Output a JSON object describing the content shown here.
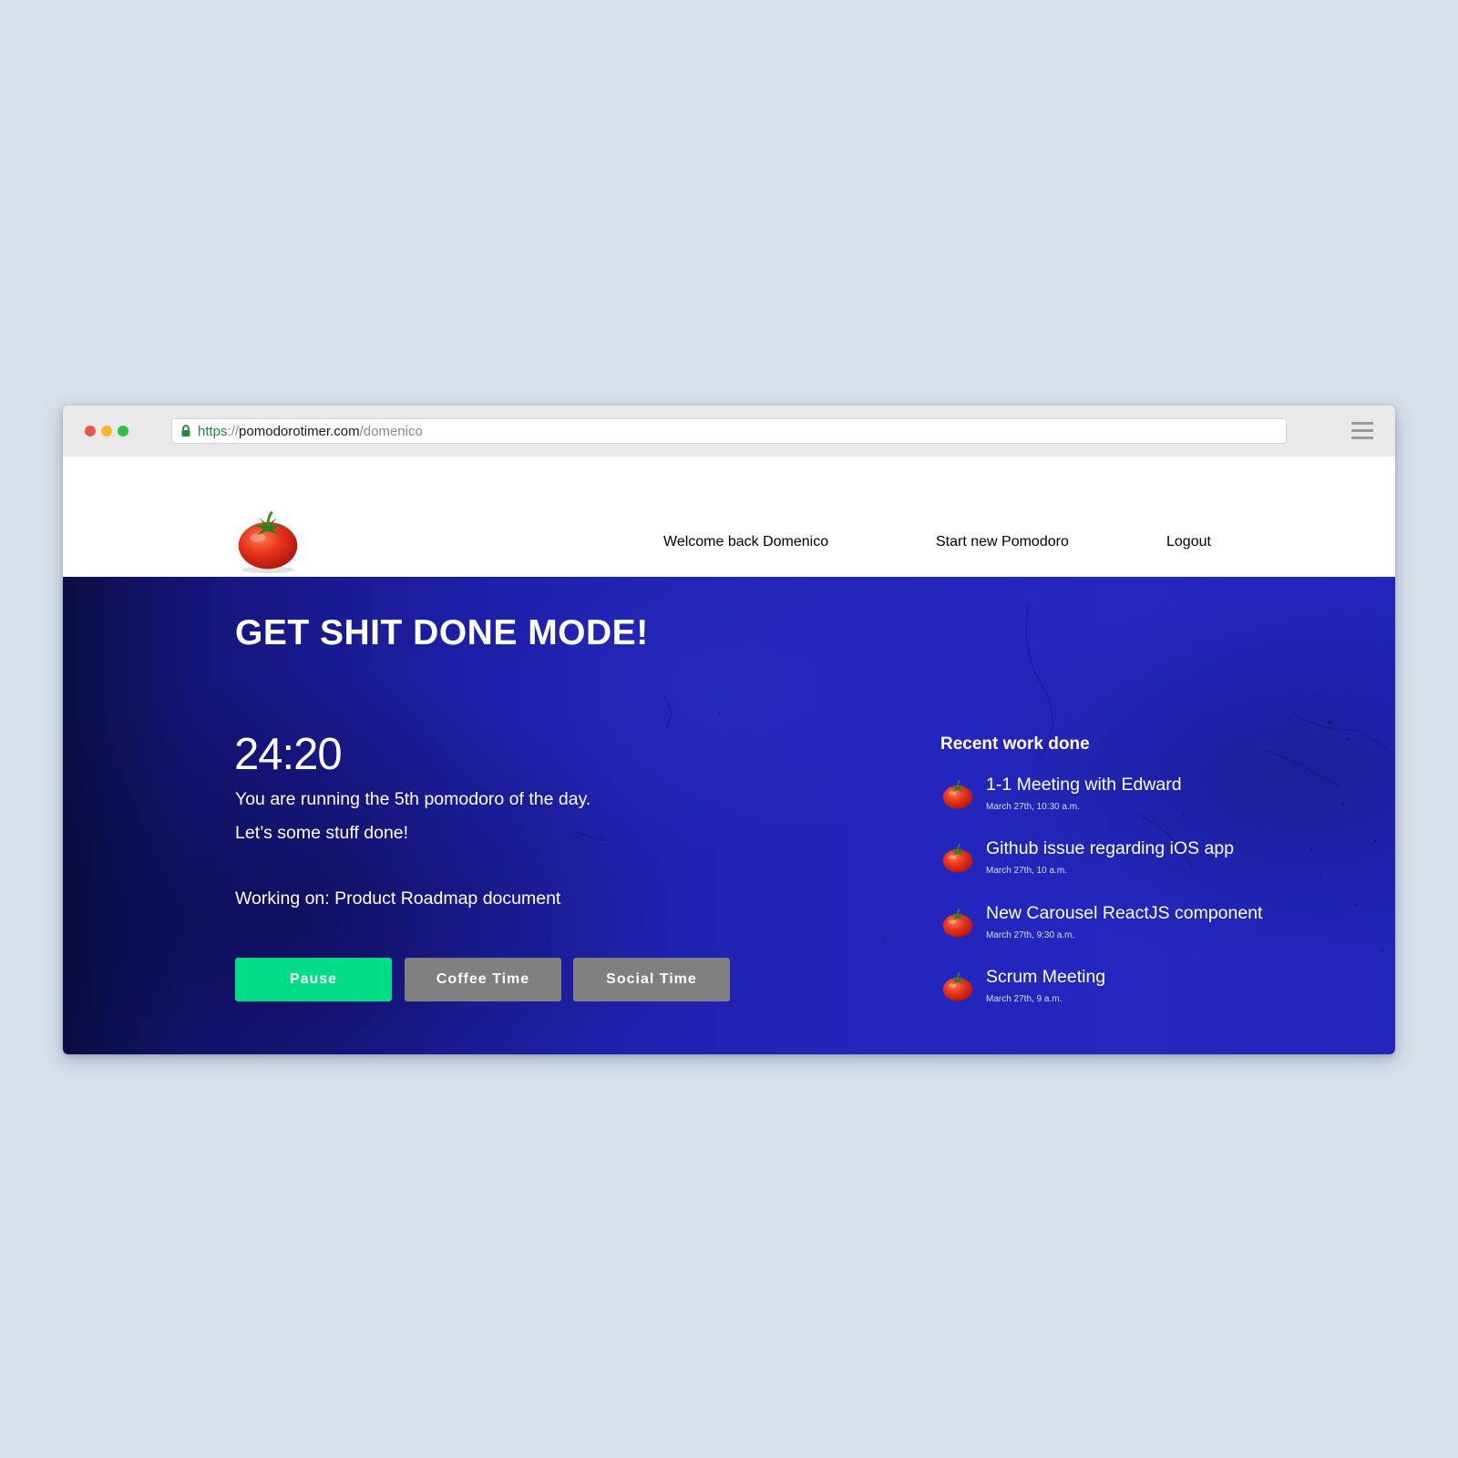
{
  "browser": {
    "url_scheme": "https",
    "url_separator": "://",
    "url_host": "pomodorotimer.com",
    "url_path": "/domenico"
  },
  "header": {
    "logo_icon": "tomato-icon",
    "nav": [
      {
        "label": "Welcome back Domenico"
      },
      {
        "label": "Start new Pomodoro"
      },
      {
        "label": "Logout"
      }
    ]
  },
  "hero": {
    "title": "GET SHIT DONE MODE!",
    "timer": "24:20",
    "message_line1": "You are running the 5th pomodoro of the day.",
    "message_line2": "Let’s some stuff done!",
    "working_on": "Working on: Product Roadmap document",
    "buttons": {
      "pause": "Pause",
      "coffee": "Coffee Time",
      "social": "Social Time"
    }
  },
  "recent": {
    "title": "Recent work done",
    "items": [
      {
        "title": "1-1 Meeting with Edward",
        "time": "March 27th, 10:30 a.m."
      },
      {
        "title": "Github issue regarding iOS app",
        "time": "March 27th, 10 a.m."
      },
      {
        "title": "New Carousel ReactJS component",
        "time": "March 27th, 9:30 a.m."
      },
      {
        "title": "Scrum Meeting",
        "time": "March 27th, 9 a.m."
      }
    ]
  },
  "colors": {
    "page_background": "#d6dfea",
    "hero_blue": "#2224b8",
    "nav_text": "#5448b4",
    "pause_green": "#00dc85",
    "secondary_gray": "#808080"
  }
}
